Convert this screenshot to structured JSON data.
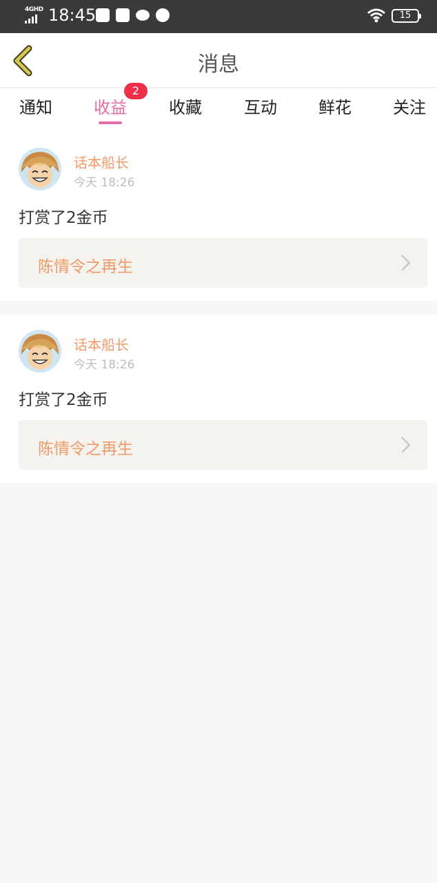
{
  "status_bar": {
    "network": "4GHD",
    "time": "18:45",
    "battery": "15",
    "icons": [
      "signal-icon",
      "mail-icon",
      "screenshot-icon",
      "chat-icon",
      "app-icon",
      "wifi-icon",
      "battery-icon"
    ]
  },
  "header": {
    "title": "消息",
    "back_icon": "chevron-left-icon"
  },
  "tabs": {
    "items": [
      {
        "label": "通知"
      },
      {
        "label": "收益",
        "badge": "2"
      },
      {
        "label": "收藏"
      },
      {
        "label": "互动"
      },
      {
        "label": "鲜花"
      },
      {
        "label": "关注"
      }
    ],
    "active_index": 1
  },
  "messages": [
    {
      "user": "话本船长",
      "time": "今天 18:26",
      "text": "打赏了2金币",
      "work_title": "陈情令之再生"
    },
    {
      "user": "话本船长",
      "time": "今天 18:26",
      "text": "打赏了2金币",
      "work_title": "陈情令之再生"
    }
  ],
  "colors": {
    "accent": "#e46ea8",
    "badge": "#f0304b",
    "username": "#ef9a6a",
    "status_bar": "#3a3a3a",
    "page_background": "#f8f6f6",
    "link_box": "#f4f3ed",
    "back_arrow": "#d8c653"
  }
}
